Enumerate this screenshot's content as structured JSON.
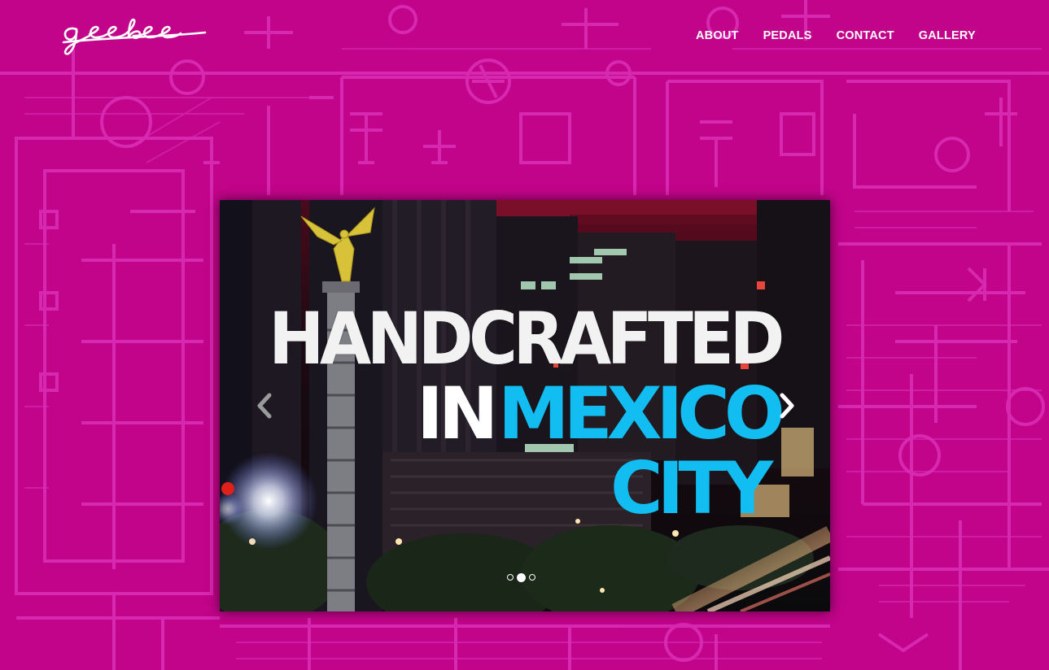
{
  "brand": {
    "logo_text": "geebee"
  },
  "nav": {
    "items": [
      {
        "label": "ABOUT"
      },
      {
        "label": "PEDALS"
      },
      {
        "label": "CONTACT"
      },
      {
        "label": "GALLERY"
      }
    ]
  },
  "slider": {
    "headline": {
      "line1": "HANDCRAFTED",
      "line2_a": "IN",
      "line2_b": "MEXICO",
      "line3": "CITY"
    },
    "slide_count": 3,
    "active_slide": 2,
    "prev_icon": "chevron-left-icon",
    "next_icon": "chevron-right-icon"
  },
  "colors": {
    "background": "#c2048a",
    "schematic_lines": "#e03cc0",
    "nav_text": "#ffffff",
    "headline_white": "#ffffff",
    "headline_cyan": "#11bdf1"
  }
}
